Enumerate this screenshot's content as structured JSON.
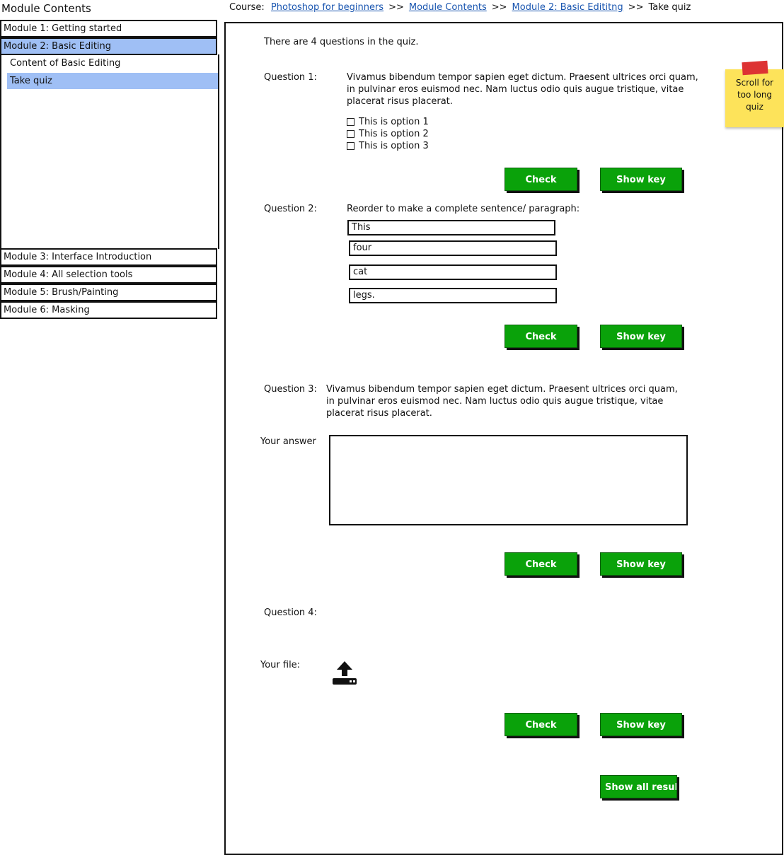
{
  "sidebar": {
    "title": "Module Contents",
    "modules": [
      "Module 1: Getting started",
      "Module 2: Basic Editing",
      "Module 3: Interface Introduction",
      "Module 4: All selection tools",
      "Module 5: Brush/Painting",
      "Module 6: Masking"
    ],
    "subitems": [
      "Content of Basic Editing",
      "Take quiz"
    ]
  },
  "breadcrumb": {
    "prefix": "Course:",
    "links": [
      "Photoshop for beginners",
      "Module Contents",
      "Module 2: Basic Edititng"
    ],
    "separator": ">>",
    "current": "Take quiz"
  },
  "quiz": {
    "intro": "There are 4 questions in the quiz.",
    "q1": {
      "label": "Question 1:",
      "text": "Vivamus bibendum tempor sapien eget dictum. Praesent ultrices orci quam, in pulvinar eros euismod nec. Nam luctus odio quis augue tristique, vitae placerat risus placerat.",
      "options": [
        "This is option 1",
        "This is option 2",
        "This is option 3"
      ]
    },
    "q2": {
      "label": "Question 2:",
      "text": "Reorder to make a complete sentence/ paragraph:",
      "words": [
        "This",
        "four",
        "cat",
        "legs."
      ]
    },
    "q3": {
      "label": "Question 3:",
      "text": "Vivamus bibendum tempor sapien eget dictum. Praesent ultrices orci quam, in pulvinar eros euismod nec. Nam luctus odio quis augue tristique, vitae placerat risus placerat.",
      "answer_label": "Your answer"
    },
    "q4": {
      "label": "Question 4:",
      "file_label": "Your file:"
    },
    "check_label": "Check",
    "key_label": "Show key",
    "show_all_label": "Show all results"
  },
  "sticky_note": "Scroll for too long quiz",
  "colors": {
    "accent_green": "#0aa20a",
    "highlight_blue": "#9fbff5",
    "link": "#1a56b0",
    "sticky": "#fde35a"
  },
  "icons": {
    "upload": "upload-icon"
  }
}
